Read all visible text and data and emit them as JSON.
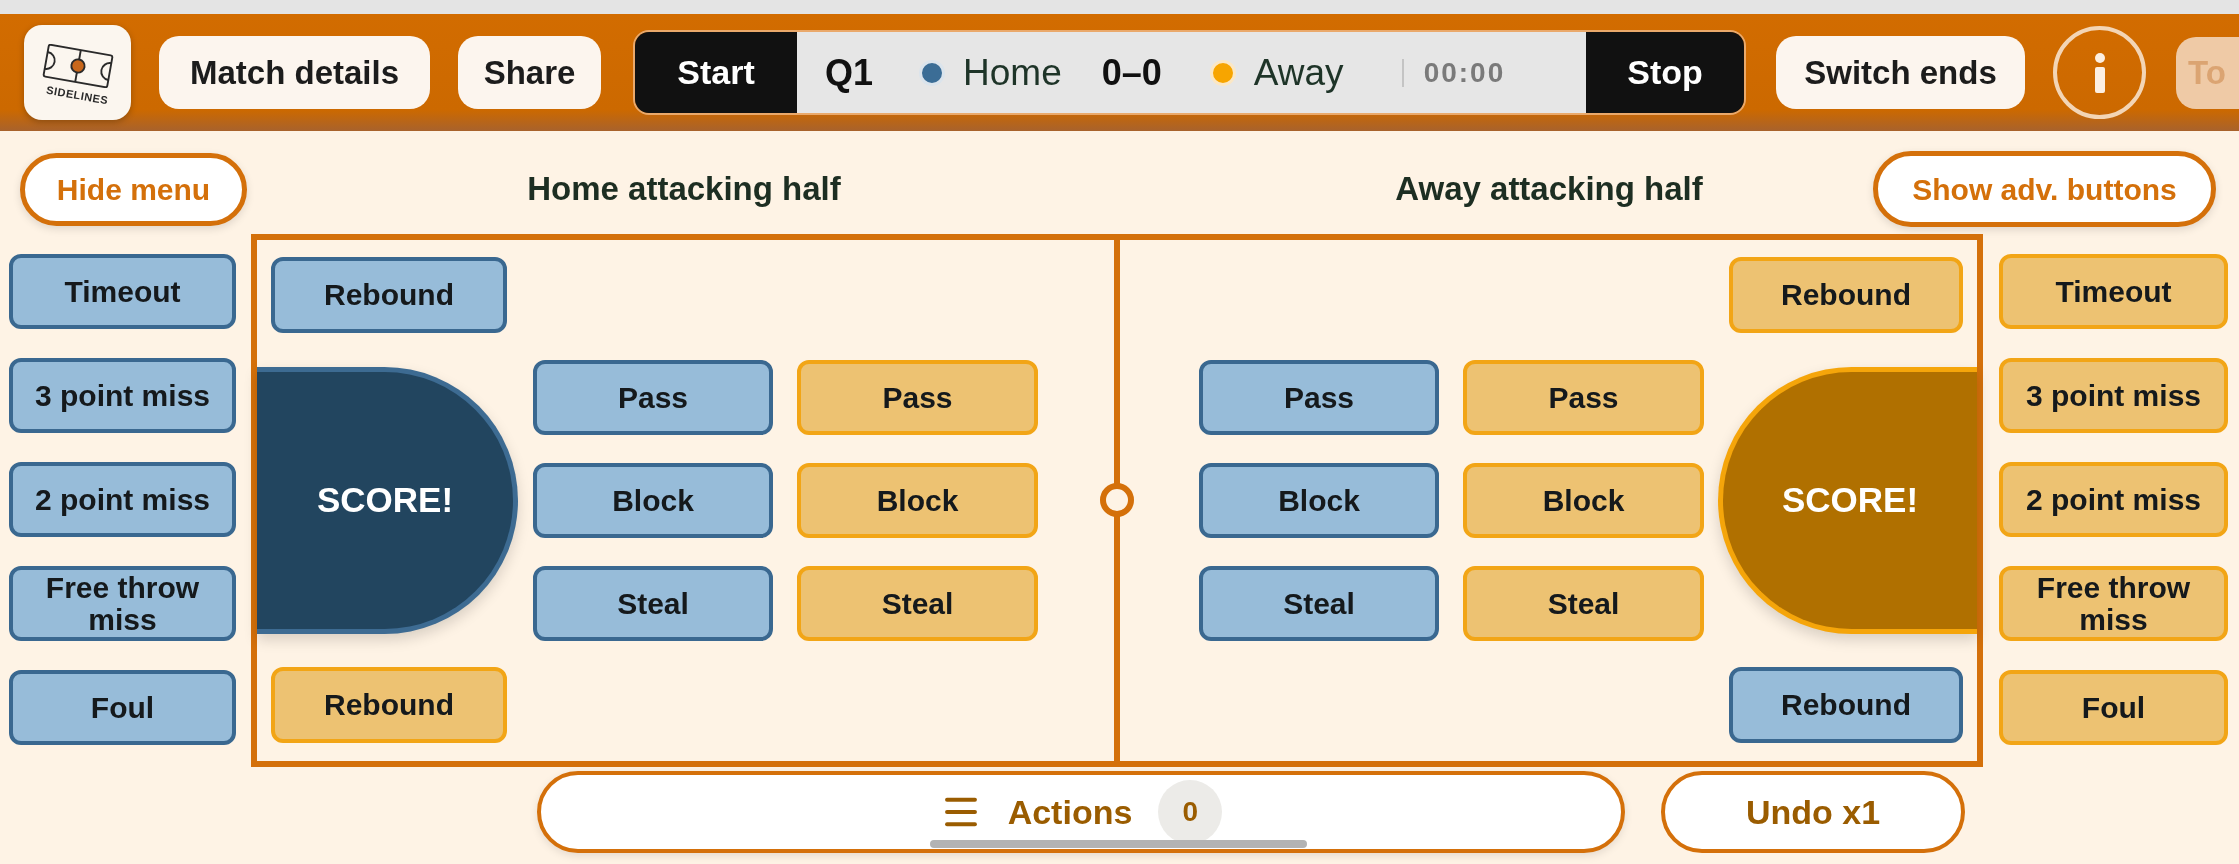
{
  "top_bar": {
    "logo_text": "SIDELINES",
    "buttons": [
      "Match details",
      "Share"
    ],
    "scoreboard": {
      "start": "Start",
      "period": "Q1",
      "home": {
        "name": "Home",
        "color": "#3b6d96"
      },
      "score": "0–0",
      "away": {
        "name": "Away",
        "color": "#f7a500"
      },
      "clock": "00:00",
      "stop": "Stop"
    },
    "switch_ends": "Switch ends",
    "cut_off_button": "To"
  },
  "header": {
    "hide_menu": "Hide menu",
    "home_half_title": "Home attacking half",
    "away_half_title": "Away attacking half",
    "show_adv_buttons": "Show adv. buttons"
  },
  "left_column": [
    {
      "label": "Timeout",
      "kind": "home"
    },
    {
      "label": "3 point miss",
      "kind": "home"
    },
    {
      "label": "2 point miss",
      "kind": "home"
    },
    {
      "label": "Free throw miss",
      "kind": "home"
    },
    {
      "label": "Foul",
      "kind": "home"
    }
  ],
  "court": {
    "home_half": {
      "top": {
        "label": "Rebound",
        "kind": "home"
      },
      "score": {
        "label": "SCORE!",
        "kind": "home"
      },
      "actions": [
        {
          "label": "Pass",
          "kind": "home"
        },
        {
          "label": "Pass",
          "kind": "away"
        },
        {
          "label": "Block",
          "kind": "home"
        },
        {
          "label": "Block",
          "kind": "away"
        },
        {
          "label": "Steal",
          "kind": "home"
        },
        {
          "label": "Steal",
          "kind": "away"
        }
      ],
      "bottom": {
        "label": "Rebound",
        "kind": "away"
      }
    },
    "away_half": {
      "top": {
        "label": "Rebound",
        "kind": "away"
      },
      "actions": [
        {
          "label": "Pass",
          "kind": "home"
        },
        {
          "label": "Pass",
          "kind": "away"
        },
        {
          "label": "Block",
          "kind": "home"
        },
        {
          "label": "Block",
          "kind": "away"
        },
        {
          "label": "Steal",
          "kind": "home"
        },
        {
          "label": "Steal",
          "kind": "away"
        }
      ],
      "score": {
        "label": "SCORE!",
        "kind": "away"
      },
      "bottom": {
        "label": "Rebound",
        "kind": "home"
      }
    }
  },
  "right_column": [
    {
      "label": "Timeout",
      "kind": "away"
    },
    {
      "label": "3 point miss",
      "kind": "away"
    },
    {
      "label": "2 point miss",
      "kind": "away"
    },
    {
      "label": "Free throw miss",
      "kind": "away"
    },
    {
      "label": "Foul",
      "kind": "away"
    }
  ],
  "bottom_bar": {
    "actions": {
      "label": "Actions",
      "count": "0"
    },
    "undo": "Undo x1"
  }
}
